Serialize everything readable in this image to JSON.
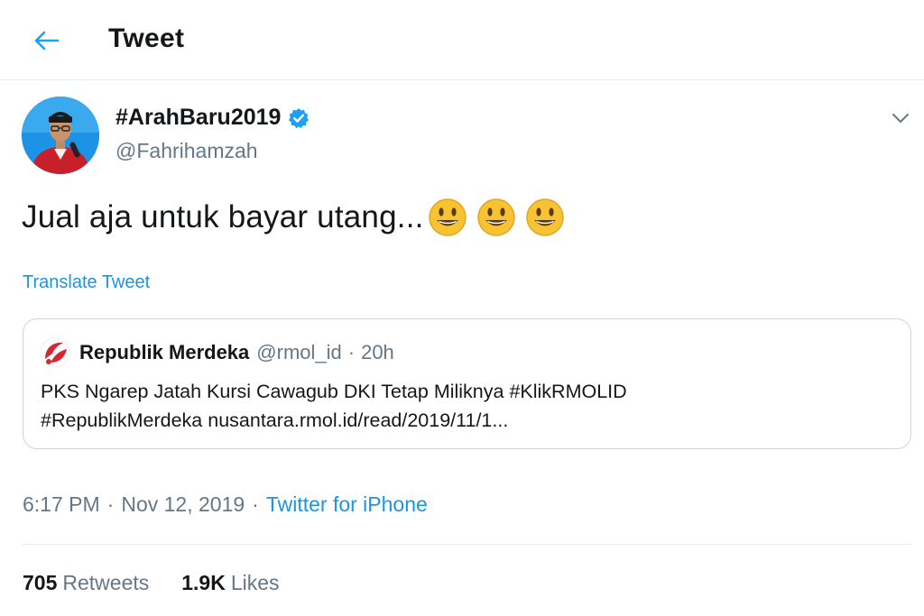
{
  "header": {
    "title": "Tweet",
    "back_icon": "arrow-left-icon"
  },
  "tweet": {
    "display_name": "#ArahBaru2019",
    "verified": true,
    "handle": "@Fahrihamzah",
    "text": "Jual aja untuk bayar utang...",
    "emojis": [
      "smiley-emoji",
      "smiley-emoji",
      "smiley-emoji"
    ],
    "translate_label": "Translate Tweet",
    "time": "6:17 PM",
    "date": "Nov 12, 2019",
    "separator": "·",
    "source": "Twitter for iPhone",
    "retweets_count": "705",
    "retweets_label": "Retweets",
    "likes_count": "1.9K",
    "likes_label": "Likes"
  },
  "quoted_tweet": {
    "name": "Republik Merdeka",
    "handle": "@rmol_id",
    "separator": "·",
    "time": "20h",
    "line1": "PKS Ngarep Jatah Kursi Cawagub DKI Tetap Miliknya #KlikRMOLID",
    "line2": " #RepublikMerdeka nusantara.rmol.id/read/2019/11/1..."
  },
  "colors": {
    "accent": "#1b95e0",
    "secondary_text": "#657786",
    "border": "#e6ecf0",
    "emoji_yellow": "#f7c233",
    "logo_red": "#d7262e"
  }
}
